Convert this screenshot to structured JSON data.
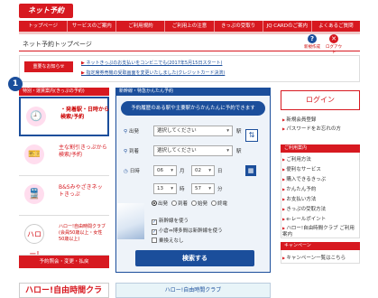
{
  "header": {
    "logo_text": "ネット予約",
    "nav": [
      "トップページ",
      "サービスのご案内",
      "ご利用規約",
      "ご利用上の注意",
      "きっぷの受取り",
      "JQ CARDのご案内",
      "よくあるご質問"
    ]
  },
  "page": {
    "title": "ネット予約トップページ",
    "help_icon_label": "?",
    "help_label": "新規作成",
    "close_icon_label": "✕",
    "close_label": "ログアウト"
  },
  "notice": {
    "badge": "重要なお知らせ",
    "links": [
      "ネットきっぷのお支払いをコンビニでも(2017年5月15日スタート)",
      "指定席券売機の受取画面を変更いたしました(クレジットカード決済)"
    ]
  },
  "menu": {
    "step_badge": "1",
    "header": "特別・運賃案内(きっぷの予約)",
    "tiles": [
      {
        "icon": "🕘",
        "label": "・発着駅・日時から検索/予約"
      },
      {
        "icon": "🎫",
        "label": "主な割引きっぷから検索/予約"
      },
      {
        "icon": "🚆",
        "label": "B&Sみやざきネットきっぷ"
      },
      {
        "icon": "ハロー!",
        "label": "ハロー!自由時間クラブ(会員50歳以上・女性50歳以上)"
      }
    ],
    "reserve_button": "予約照会・変更・払戻",
    "club_banner": "ハロー!自由時間クラブ"
  },
  "search": {
    "header": "新幹線・特急かんたん予約",
    "history_link": "予約履歴のある駅や主要駅からかんたんに予約できます",
    "departure_label": "出発",
    "arrival_label": "到着",
    "date_label": "日時",
    "station_placeholder": "選択してください",
    "station_suffix": "駅",
    "month": "06",
    "month_suffix": "月",
    "day": "02",
    "day_suffix": "日",
    "hour": "13",
    "hour_suffix": "時",
    "minute": "57",
    "minute_suffix": "分",
    "swap_icon": "⇅",
    "calendar_icon": "▦",
    "radio_options": [
      "出発",
      "到着",
      "始発",
      "終電"
    ],
    "checkboxes": [
      "新幹線を使う",
      "小倉⇔博多間は新幹線を使う",
      "乗換えなし"
    ],
    "search_button": "検索する",
    "bottom_banner": "ハロー!自由時間クラブ"
  },
  "right": {
    "login_button": "ログイン",
    "links": [
      "新規会員登録",
      "パスワードをお忘れの方"
    ],
    "guide_header": "ご利用案内",
    "guide_links": [
      "ご利用方法",
      "便利なサービス",
      "購入できるきっぷ",
      "かんたん予約",
      "お支払い方法",
      "きっぷの受取方法",
      "e-レールポイント",
      "ハロー!自由時間クラブ ご利用案内"
    ],
    "campaign_header": "キャンペーン",
    "campaign_link": "キャンペーン一覧はこちら"
  },
  "colors": {
    "brand_red": "#d71920",
    "accent_blue": "#1b4e9b"
  }
}
